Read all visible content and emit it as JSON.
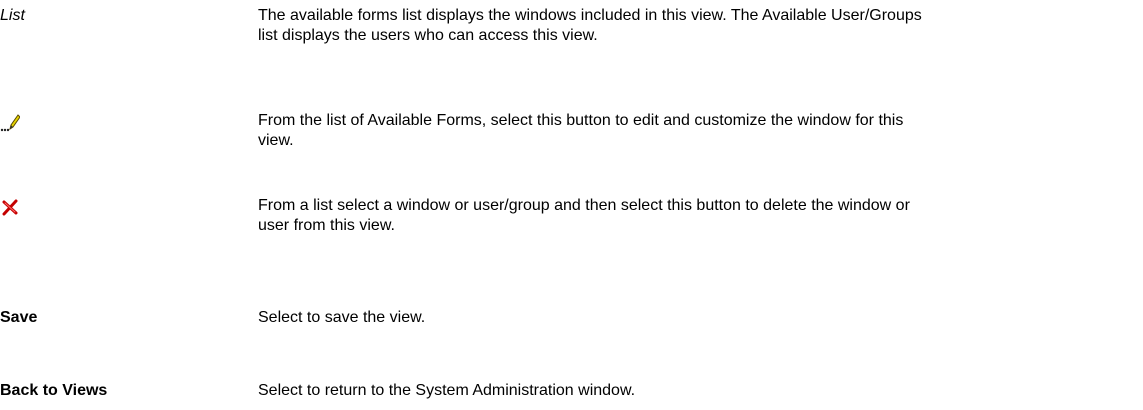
{
  "rows": [
    {
      "term": "List",
      "description": "The available forms list displays the windows included in this view. The Available User/Groups\nlist displays the users who can access this view."
    },
    {
      "icon": "edit-pencil-icon",
      "description": "From the list of Available Forms, select this button to edit and customize the window for this\nview."
    },
    {
      "icon": "delete-x-icon",
      "description": "From a list select a window or user/group and then select this button to delete the window or\nuser from this view."
    },
    {
      "term": "Save",
      "description": "Select to save the view."
    },
    {
      "term": "Back to Views",
      "description": "Select to return to the System Administration window."
    }
  ],
  "colors": {
    "text": "#000000",
    "pencil_body": "#e8d400",
    "pencil_outline": "#5a4a00",
    "delete_x": "#c40000"
  }
}
